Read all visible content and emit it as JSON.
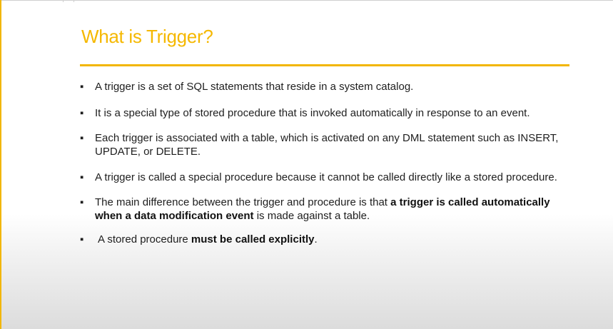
{
  "slide": {
    "title": "What is Trigger?",
    "bullet_symbol": "▪",
    "accent_color": "#f5b800",
    "bullets": [
      {
        "text": "A trigger is a set of SQL statements that reside in a system catalog."
      },
      {
        "text": "It is a special type of stored procedure that is invoked automatically in response to an event."
      },
      {
        "text": "Each trigger is associated with a table, which is activated on any DML statement such as INSERT, UPDATE, or DELETE."
      },
      {
        "text": "A trigger is called a special procedure because it cannot be called directly like a stored procedure."
      },
      {
        "text_before": "The main difference between the trigger and procedure is that ",
        "bold": "a trigger is called automatically when a data modification event",
        "text_after": " is made against a table."
      },
      {
        "text_before": "A stored procedure ",
        "bold": "must be called explicitly",
        "text_after": "."
      }
    ]
  }
}
